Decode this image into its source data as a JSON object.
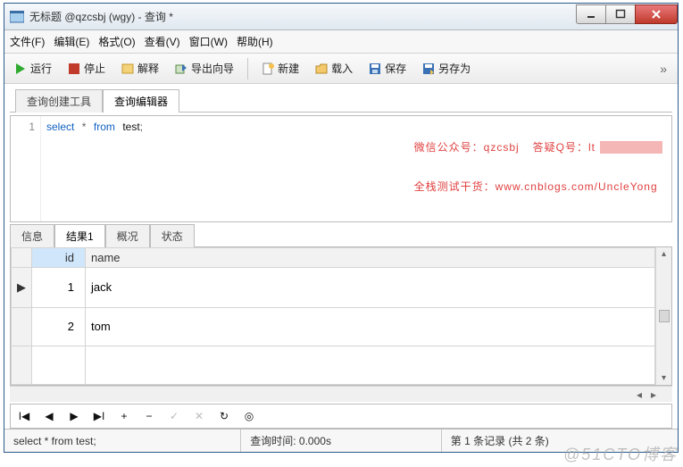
{
  "titlebar": {
    "title": "无标题 @qzcsbj (wgy) - 查询 *"
  },
  "menu": {
    "file": "文件(F)",
    "edit": "编辑(E)",
    "format": "格式(O)",
    "view": "查看(V)",
    "window": "窗口(W)",
    "help": "帮助(H)"
  },
  "toolbar": {
    "run": "运行",
    "stop": "停止",
    "explain": "解释",
    "export": "导出向导",
    "new": "新建",
    "load": "载入",
    "save": "保存",
    "saveas": "另存为"
  },
  "upperTabs": {
    "builder": "查询创建工具",
    "editor": "查询编辑器"
  },
  "sql": {
    "lineno": "1",
    "select": "select",
    "star": "*",
    "from": "from",
    "table": "test",
    "semi": ";"
  },
  "watermark": {
    "line1a": "微信公众号：",
    "line1b": "qzcsbj",
    "line1c": "答疑Q号：",
    "line1d": "lt",
    "line2a": "全栈测试干货：",
    "line2b": "www.cnblogs.com/UncleYong"
  },
  "resultTabs": {
    "info": "信息",
    "result1": "结果1",
    "profile": "概况",
    "status": "状态"
  },
  "grid": {
    "cols": {
      "id": "id",
      "name": "name"
    },
    "rows": [
      {
        "marker": "▶",
        "id": "1",
        "name": "jack"
      },
      {
        "marker": "",
        "id": "2",
        "name": "tom"
      }
    ]
  },
  "nav": {
    "first": "I◀",
    "prev": "◀",
    "play": "▶",
    "last": "▶I",
    "plus": "+",
    "minus": "−",
    "check": "✓",
    "x": "✕",
    "refresh": "↻",
    "disc": "◎"
  },
  "status": {
    "query": "select * from test;",
    "time_label": "查询时间:",
    "time_val": "0.000s",
    "pos": "第 1 条记录 (共 2 条)"
  },
  "brand": "@51CTO博客"
}
